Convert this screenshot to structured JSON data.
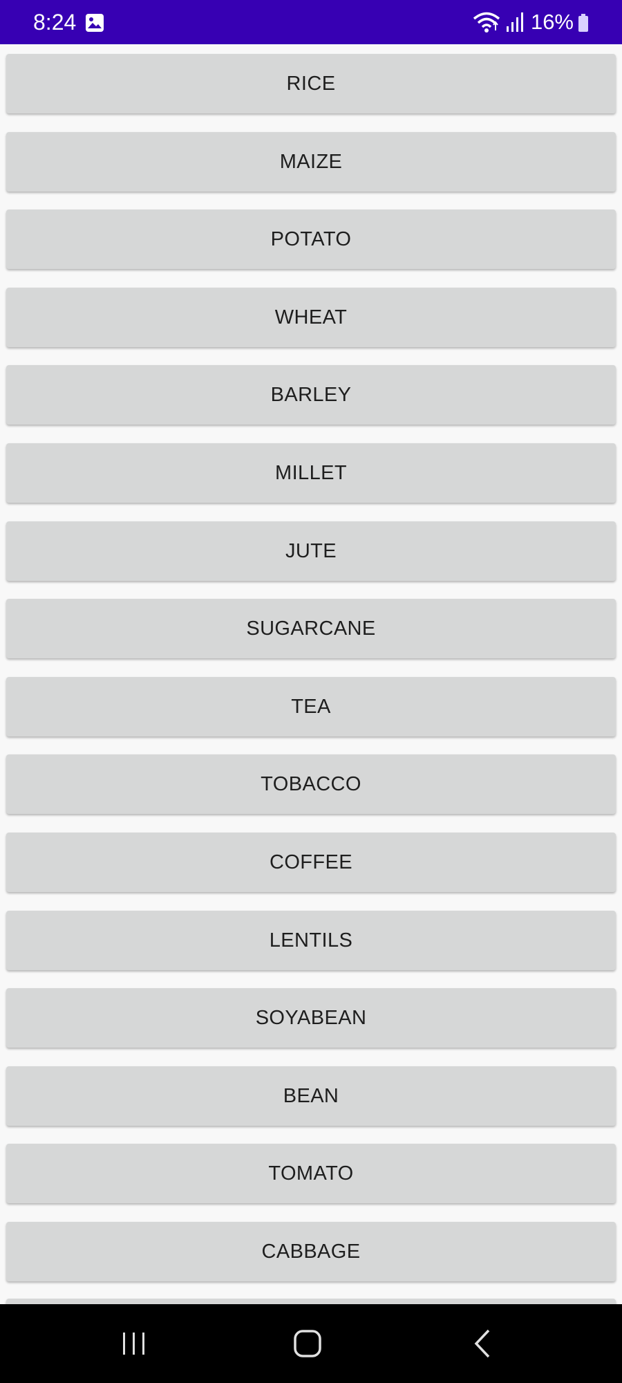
{
  "status_bar": {
    "time": "8:24",
    "battery": "16%",
    "icons": [
      "image-notification-icon",
      "wifi-icon",
      "signal-icon",
      "battery-icon"
    ],
    "background": "#3700b3"
  },
  "crops": [
    "RICE",
    "MAIZE",
    "POTATO",
    "WHEAT",
    "BARLEY",
    "MILLET",
    "JUTE",
    "SUGARCANE",
    "TEA",
    "TOBACCO",
    "COFFEE",
    "LENTILS",
    "SOYABEAN",
    "BEAN",
    "TOMATO",
    "CABBAGE"
  ],
  "nav_bar": {
    "icons": [
      "recents-icon",
      "home-icon",
      "back-icon"
    ]
  }
}
